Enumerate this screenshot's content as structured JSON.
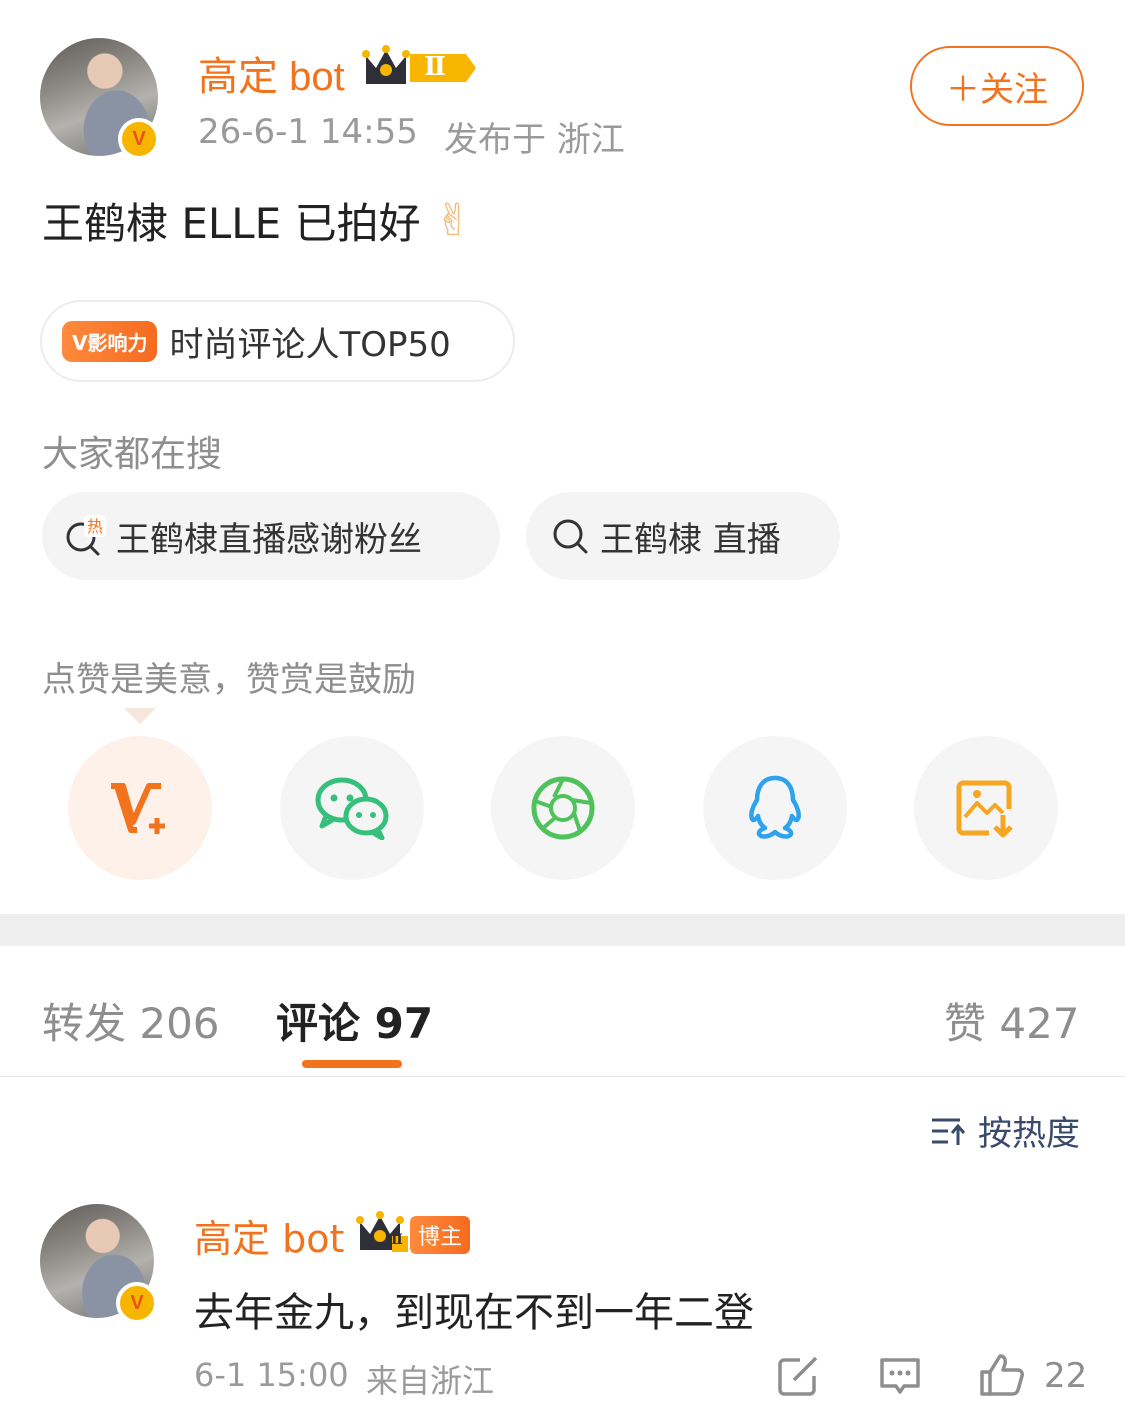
{
  "post": {
    "author": "高定 bot",
    "level_badge": "Ⅱ",
    "timestamp": "26-6-1 14:55",
    "location": "发布于 浙江",
    "follow_label": "＋关注",
    "text": "王鹤棣 ELLE 已拍好",
    "emoji": "✌"
  },
  "influence": {
    "tag": "V影响力",
    "label": "时尚评论人TOP50"
  },
  "trending": {
    "title": "大家都在搜",
    "items": [
      {
        "label": "王鹤棣直播感谢粉丝",
        "icon": "hot-search-icon"
      },
      {
        "label": "王鹤棣 直播",
        "icon": "search-icon"
      }
    ]
  },
  "reward": {
    "text": "点赞是美意，赞赏是鼓励"
  },
  "share": [
    {
      "name": "v-plus-icon",
      "color": "#f2731d"
    },
    {
      "name": "wechat-icon",
      "color": "#36c07b"
    },
    {
      "name": "moments-icon",
      "color": "#4fc25c"
    },
    {
      "name": "qq-icon",
      "color": "#2ea2ec"
    },
    {
      "name": "save-image-icon",
      "color": "#f5a623"
    }
  ],
  "tabs": {
    "repost": "转发 206",
    "comments": "评论 97",
    "likes": "赞 427"
  },
  "sort": {
    "label": "按热度"
  },
  "comment": {
    "author": "高定 bot",
    "level_badge": "Ⅱ",
    "role_badge": "博主",
    "text": "去年金九，到现在不到一年二登",
    "timestamp": "6-1 15:00",
    "location": "来自浙江",
    "like_count": "22"
  },
  "colors": {
    "accent": "#f2731d",
    "gold": "#f7b500"
  }
}
